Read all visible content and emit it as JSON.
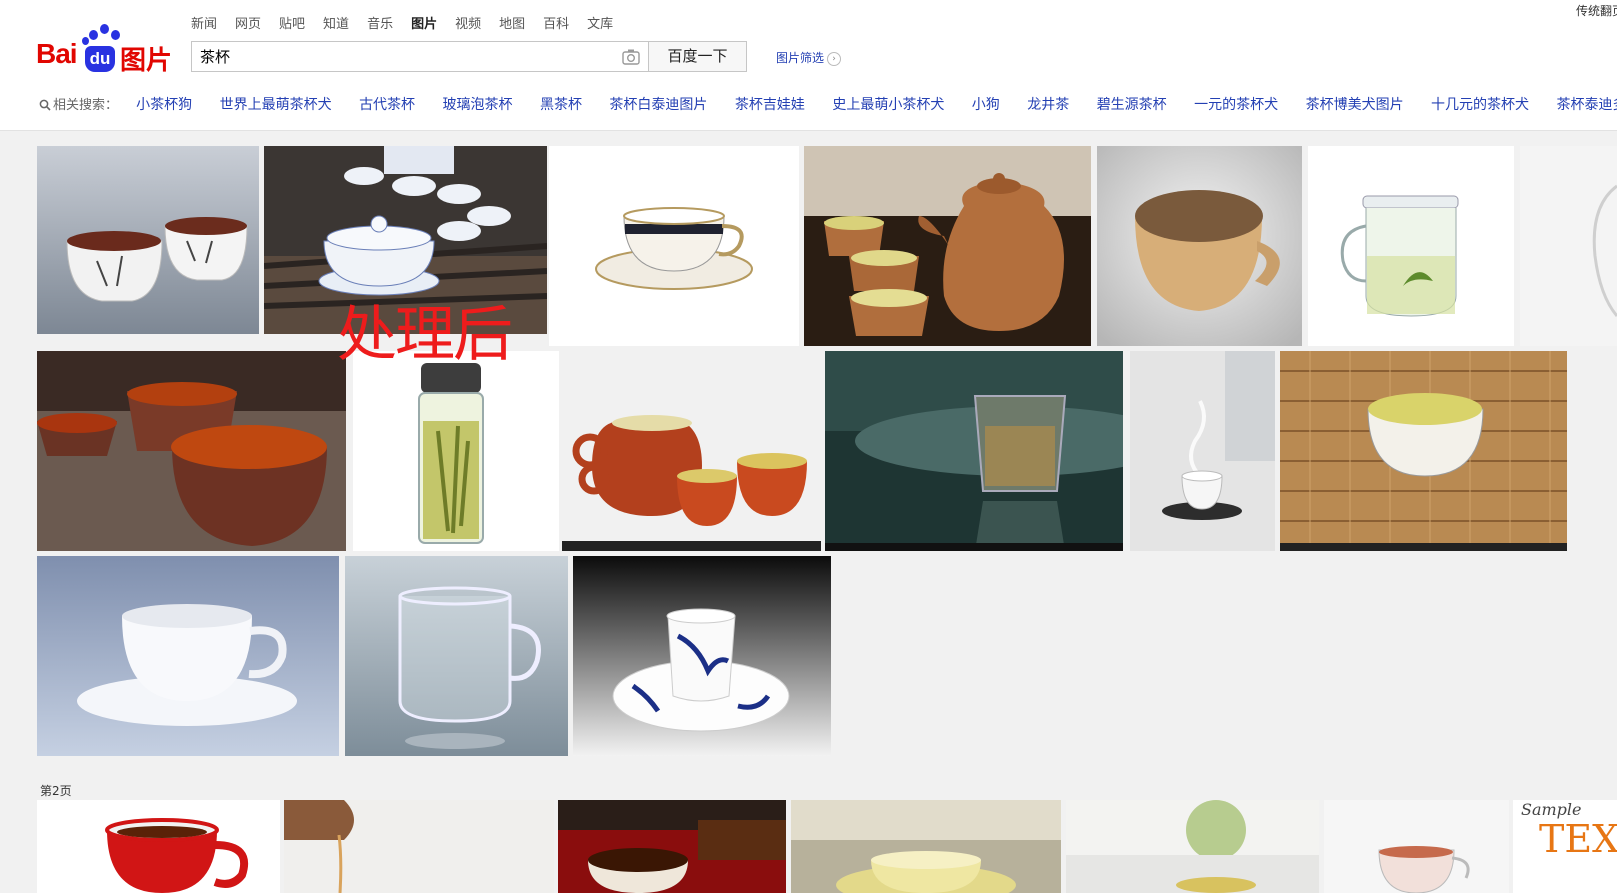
{
  "logo": {
    "bai": "Bai",
    "du": "du",
    "tupian": "图片"
  },
  "nav": [
    "新闻",
    "网页",
    "贴吧",
    "知道",
    "音乐",
    "图片",
    "视频",
    "地图",
    "百科",
    "文库"
  ],
  "nav_active": "图片",
  "search": {
    "value": "茶杯",
    "button_label": "百度一下"
  },
  "filter_label": "图片筛选",
  "top_right": "传统翻页",
  "related": {
    "label": "相关搜索：",
    "items": [
      "小茶杯狗",
      "世界上最萌茶杯犬",
      "古代茶杯",
      "玻璃泡茶杯",
      "黑茶杯",
      "茶杯白泰迪图片",
      "茶杯吉娃娃",
      "史上最萌小茶杯犬",
      "小狗",
      "龙井茶",
      "碧生源茶杯",
      "一元的茶杯犬",
      "茶杯博美犬图片",
      "十几元的茶杯犬",
      "茶杯泰迪多少元"
    ]
  },
  "overlay_text": "处理后",
  "page2_label": "第2页",
  "colors": {
    "brand_red": "#e10601",
    "brand_blue": "#2932e1",
    "link": "#2440b3",
    "overlay": "#ee1c1c"
  }
}
